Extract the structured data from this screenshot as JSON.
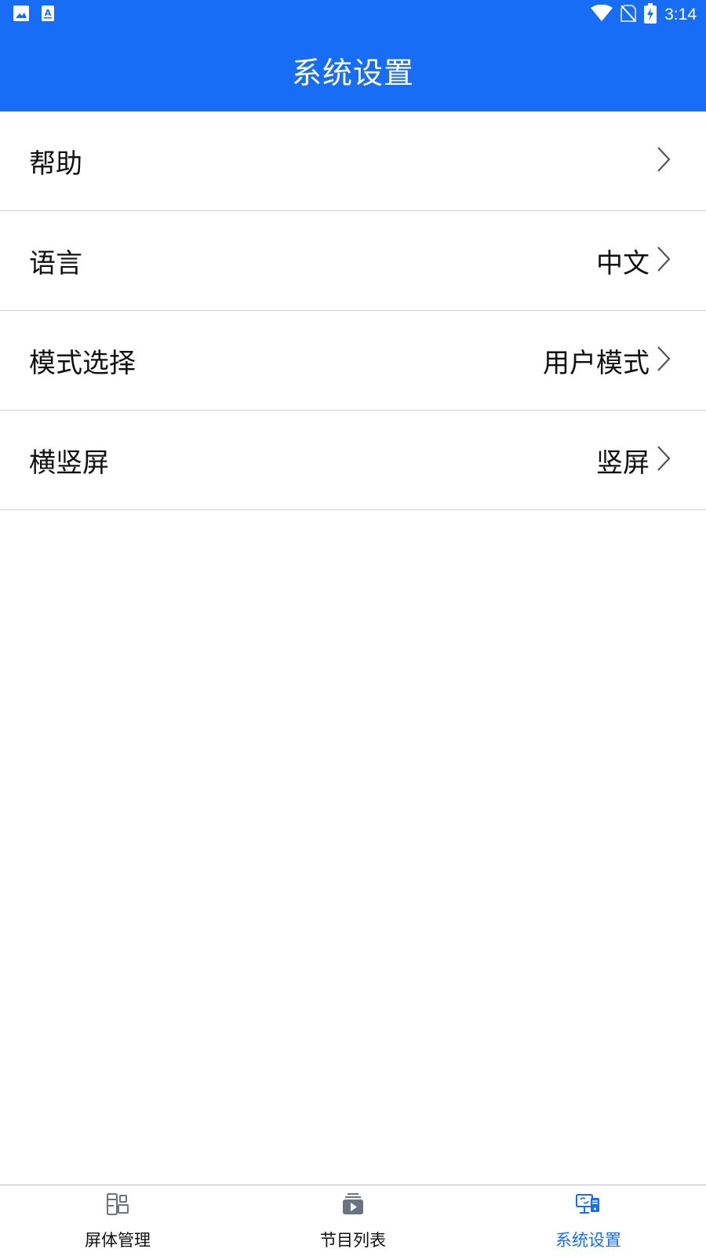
{
  "status_bar": {
    "time": "3:14",
    "icons": [
      "image-icon",
      "text-a-icon",
      "wifi-icon",
      "no-sim-icon",
      "battery-charging-icon"
    ]
  },
  "header": {
    "title": "系统设置"
  },
  "settings": {
    "items": [
      {
        "label": "帮助",
        "value": ""
      },
      {
        "label": "语言",
        "value": "中文"
      },
      {
        "label": "模式选择",
        "value": "用户模式"
      },
      {
        "label": "横竖屏",
        "value": "竖屏"
      }
    ]
  },
  "bottom_nav": {
    "items": [
      {
        "label": "屏体管理",
        "icon": "screen-management-icon",
        "active": false
      },
      {
        "label": "节目列表",
        "icon": "program-list-icon",
        "active": false
      },
      {
        "label": "系统设置",
        "icon": "system-settings-icon",
        "active": true
      }
    ]
  },
  "colors": {
    "primary": "#186df7",
    "divider": "#cfcfcf",
    "icon_gray": "#6b7280"
  }
}
